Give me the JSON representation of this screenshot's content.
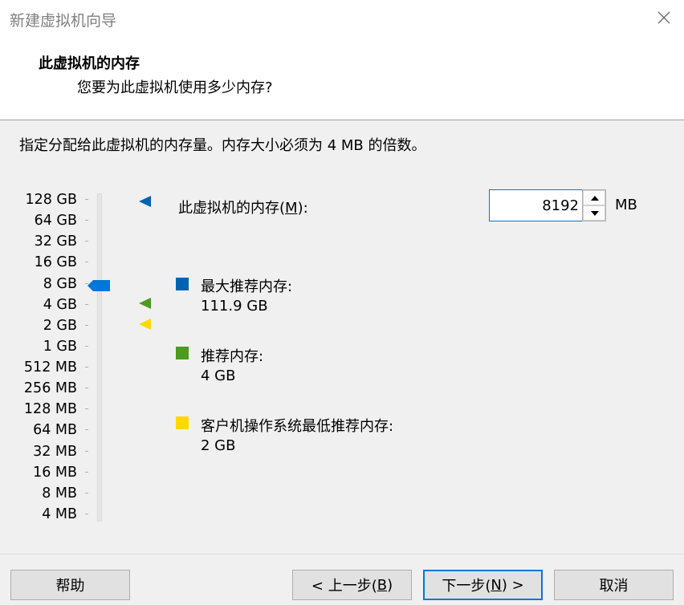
{
  "window": {
    "title": "新建虚拟机向导"
  },
  "header": {
    "title": "此虚拟机的内存",
    "subtitle": "您要为此虚拟机使用多少内存?"
  },
  "instruction": "指定分配给此虚拟机的内存量。内存大小必须为 4 MB 的倍数。",
  "scale": {
    "labels": [
      "128 GB",
      "64 GB",
      "32 GB",
      "16 GB",
      "8 GB",
      "4 GB",
      "2 GB",
      "1 GB",
      "512 MB",
      "256 MB",
      "128 MB",
      "64 MB",
      "32 MB",
      "16 MB",
      "8 MB",
      "4 MB"
    ],
    "selected": "8 GB"
  },
  "memory": {
    "label_prefix": "此虚拟机的内存(",
    "label_key": "M",
    "label_suffix": "):",
    "value": "8192",
    "unit": "MB"
  },
  "legend": [
    {
      "label": "最大推荐内存:",
      "value": "111.9 GB",
      "color": "#0063b1"
    },
    {
      "label": "推荐内存:",
      "value": "4 GB",
      "color": "#4c9a1e"
    },
    {
      "label": "客户机操作系统最低推荐内存:",
      "value": "2 GB",
      "color": "#ffd800"
    }
  ],
  "colors": {
    "accent": "#0078d7",
    "thumb": "#0078d7"
  },
  "icons": {
    "close": "close-icon",
    "spin_up": "triangle-up-icon",
    "spin_down": "triangle-down-icon"
  },
  "buttons": {
    "help": "帮助",
    "back_prefix": "< 上一步(",
    "back_key": "B",
    "back_suffix": ")",
    "next_prefix": "下一步(",
    "next_key": "N",
    "next_suffix": ") >",
    "cancel": "取消"
  }
}
